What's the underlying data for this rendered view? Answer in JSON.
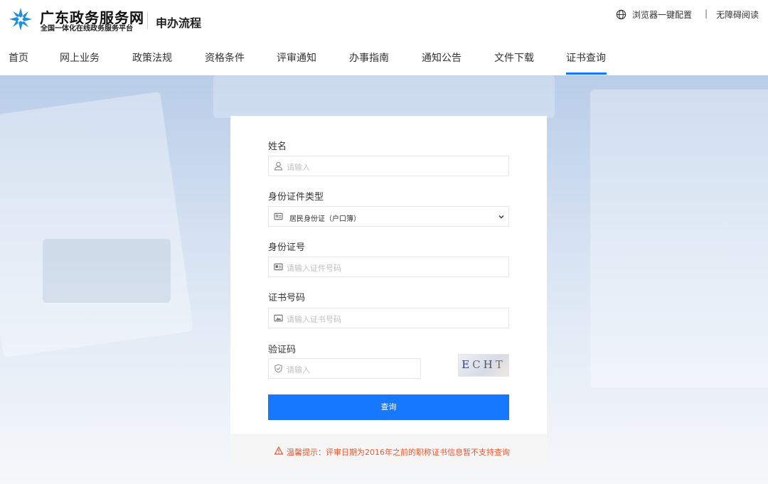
{
  "header": {
    "brand_title": "广东政务服务网",
    "brand_sub": "全国一体化在线政务服务平台",
    "section_title": "申办流程",
    "browser_config": "浏览器一键配置",
    "separator": "|",
    "accessible_read": "无障碍阅读",
    "icons": {
      "logo": "star-logo-icon",
      "globe": "globe-icon"
    }
  },
  "nav": {
    "items": [
      {
        "label": "首页"
      },
      {
        "label": "网上业务"
      },
      {
        "label": "政策法规"
      },
      {
        "label": "资格条件"
      },
      {
        "label": "评审通知"
      },
      {
        "label": "办事指南"
      },
      {
        "label": "通知公告"
      },
      {
        "label": "文件下载"
      },
      {
        "label": "证书查询"
      }
    ],
    "active_index": 8
  },
  "form": {
    "name_label": "姓名",
    "name_placeholder": "请输入",
    "id_type_label": "身份证件类型",
    "id_type_value": "居民身份证（户口簿）",
    "id_number_label": "身份证号",
    "id_number_placeholder": "请输入证件号码",
    "cert_number_label": "证书号码",
    "cert_number_placeholder": "请输入证书号码",
    "captcha_label": "验证码",
    "captcha_placeholder": "请输入",
    "captcha_text": [
      "E",
      "C",
      "H",
      "T"
    ],
    "submit_label": "查询"
  },
  "notice": {
    "text": "温馨提示：评审日期为2016年之前的职称证书信息暂不支持查询"
  },
  "colors": {
    "accent": "#1677ff",
    "warning": "#e8572f",
    "logo": "#1e8fd8"
  }
}
